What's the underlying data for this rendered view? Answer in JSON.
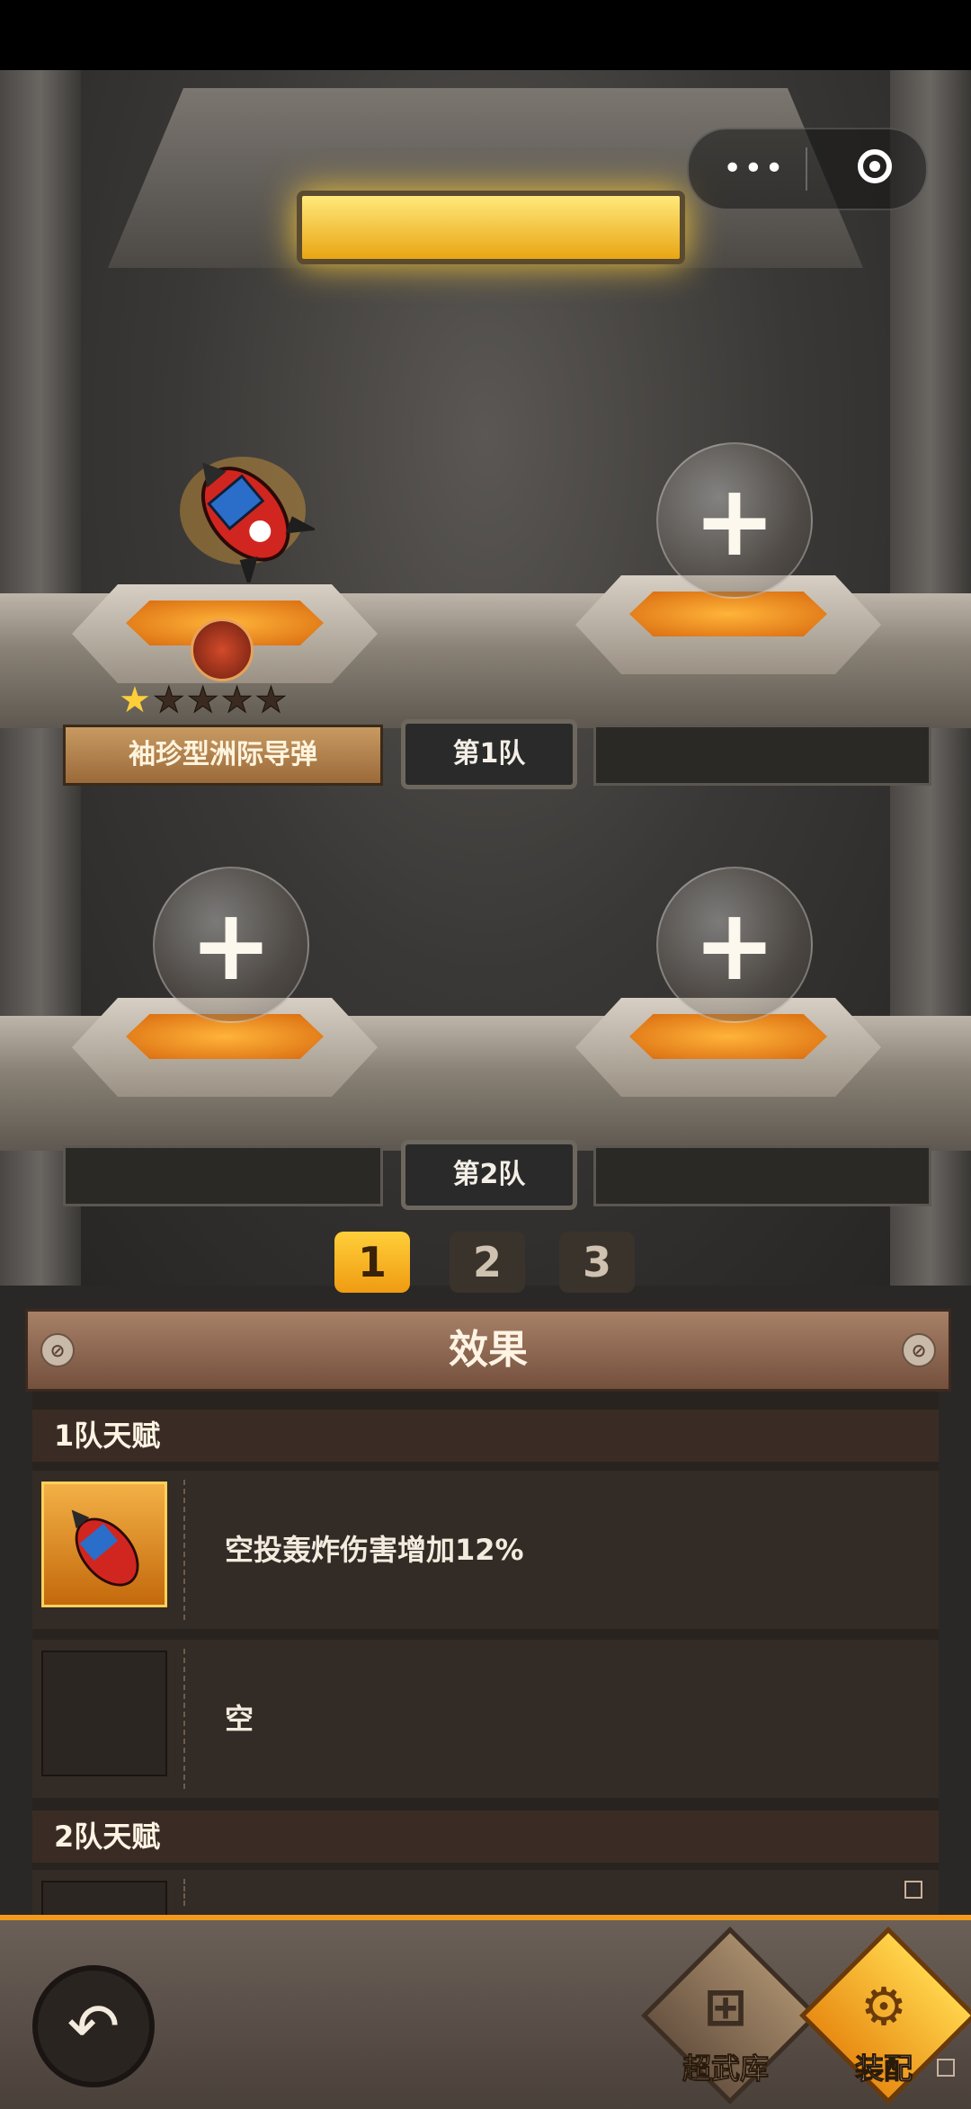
{
  "header": {
    "more_label": "•••"
  },
  "team1": {
    "weapon_name": "袖珍型洲际导弹",
    "stars_on": 1,
    "stars_total": 5,
    "label": "第1队",
    "add_label": "+"
  },
  "team2": {
    "label": "第2队",
    "add_label": "+"
  },
  "pages": [
    "1",
    "2",
    "3"
  ],
  "active_page": 1,
  "effect": {
    "title": "效果",
    "section1_title": "1队天赋",
    "row1_text": "空投轰炸伤害增加12%",
    "row2_text": "空",
    "section2_title": "2队天赋"
  },
  "bottom": {
    "back_icon": "↶",
    "store_label": "超武库",
    "equip_label": "装配"
  },
  "colors": {
    "accent": "#f39a1c",
    "active_page": "#ffcf3a",
    "star_on": "#ffcf3a"
  }
}
